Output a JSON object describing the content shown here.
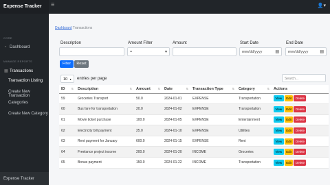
{
  "app": {
    "brand": "Expense Tracker",
    "footer": "Expense Tracker"
  },
  "sidebar": {
    "core_heading": "CORE",
    "dashboard": "Dashboard",
    "manage_heading": "MANAGE REPORTS",
    "transactions": "Transactions",
    "sub_items": [
      "Transaction Listing",
      "Create New Transaction",
      "Categories",
      "Create New Category"
    ]
  },
  "breadcrumb": {
    "link": "Dashboard",
    "current": "Transactions"
  },
  "filters": {
    "description_label": "Description",
    "amount_filter_label": "Amount Filter",
    "amount_filter_value": "=",
    "amount_label": "Amount",
    "start_date_label": "Start Date",
    "start_date_placeholder": "mm/dd/yyyy",
    "end_date_label": "End Date",
    "end_date_placeholder": "mm/dd/yyyy",
    "filter_button": "Filter",
    "reset_button": "Reset"
  },
  "listing": {
    "page_length": "10",
    "entries_text": "entries per page",
    "search_placeholder": "Search..."
  },
  "table": {
    "headers": [
      "ID",
      "Description",
      "Amount",
      "Date",
      "Transaction Type",
      "Category",
      "Actions"
    ],
    "rows": [
      [
        "59",
        "Groceries Transport",
        "50.0",
        "2024-01-01",
        "EXPENSE",
        "Transportation"
      ],
      [
        "60",
        "Bus fare for transportation",
        "20.0",
        "2024-01-02",
        "EXPENSE",
        "Transportation"
      ],
      [
        "61",
        "Movie ticket purchase",
        "100.0",
        "2024-01-05",
        "EXPENSE",
        "Entertainment"
      ],
      [
        "62",
        "Electricity bill payment",
        "25.0",
        "2024-01-10",
        "EXPENSE",
        "Utilities"
      ],
      [
        "63",
        "Rent payment for January",
        "600.0",
        "2024-01-15",
        "EXPENSE",
        "Rent"
      ],
      [
        "64",
        "Freelance project income",
        "200.0",
        "2024-01-20",
        "INCOME",
        "Groceries"
      ],
      [
        "65",
        "Bonus payment",
        "150.0",
        "2024-01-22",
        "INCOME",
        "Transportation"
      ]
    ],
    "actions": {
      "view": "View",
      "edit": "Edit",
      "delete": "Delete"
    }
  }
}
